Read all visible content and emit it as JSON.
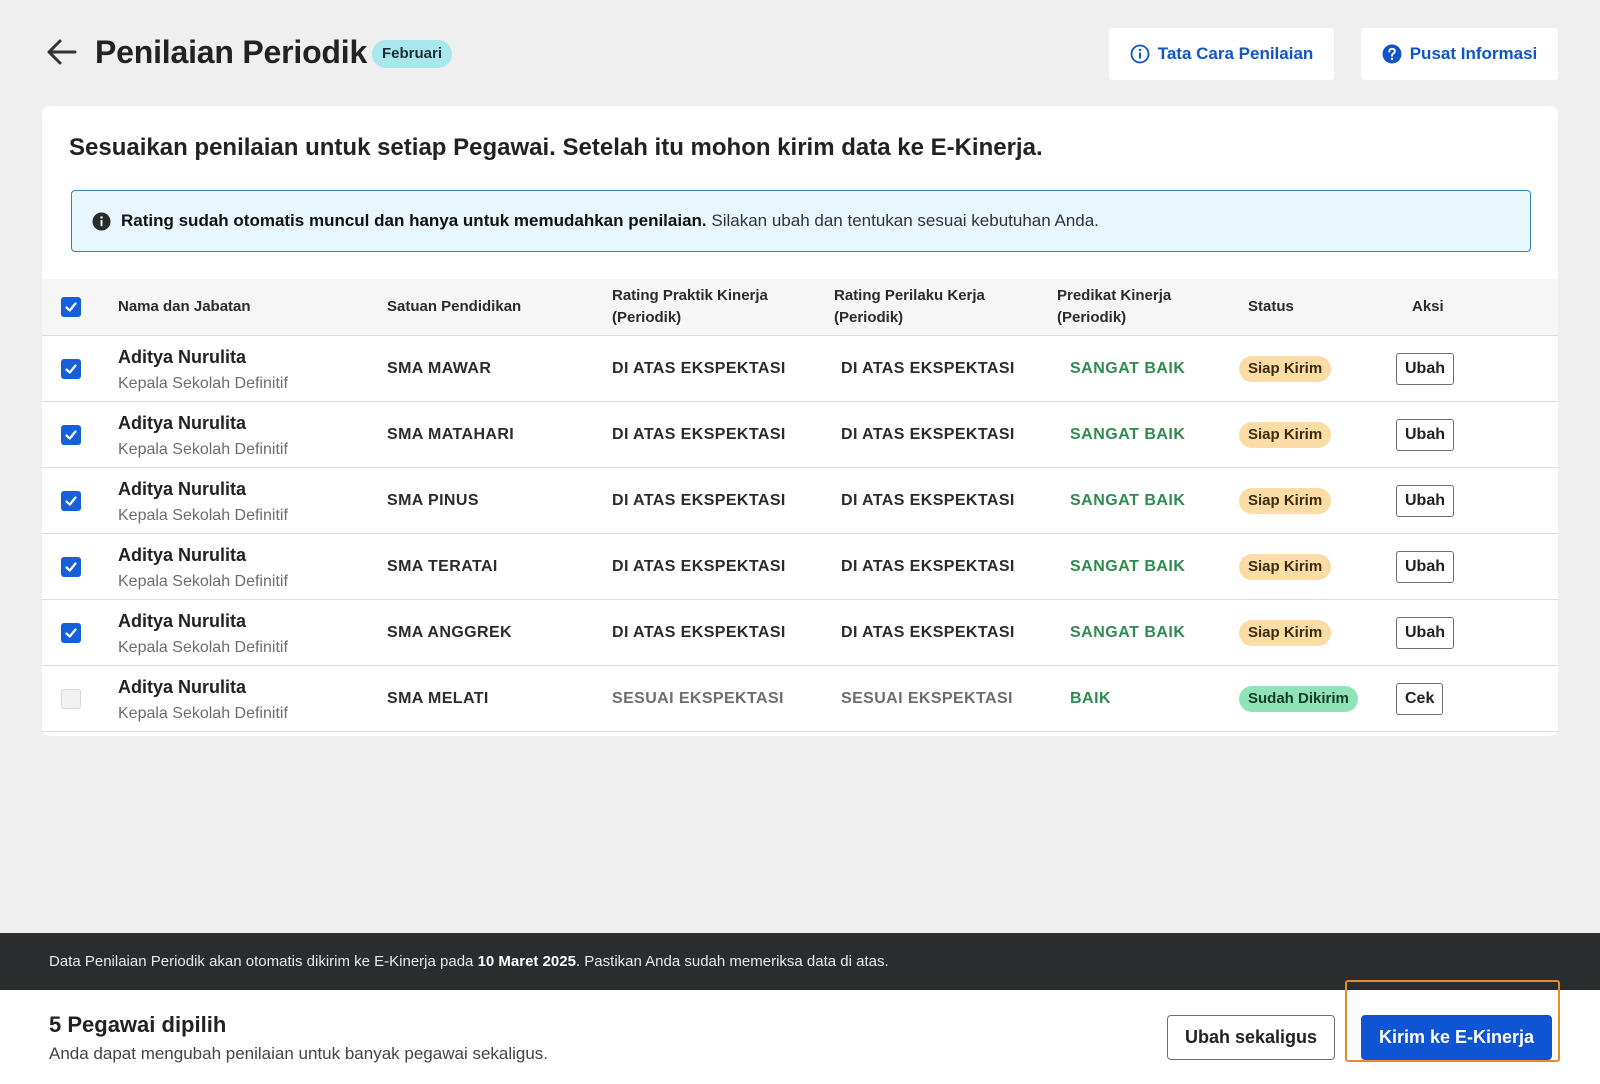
{
  "header": {
    "title": "Penilaian Periodik",
    "month_badge": "Februari",
    "tata_cara_label": "Tata Cara Penilaian",
    "pusat_info_label": "Pusat Informasi"
  },
  "card": {
    "heading": "Sesuaikan penilaian untuk setiap Pegawai. Setelah itu mohon kirim data ke E-Kinerja.",
    "info_bold": "Rating sudah otomatis muncul dan hanya untuk memudahkan penilaian.",
    "info_rest": "Silakan ubah dan tentukan sesuai kebutuhan Anda."
  },
  "table": {
    "columns": {
      "name": "Nama dan Jabatan",
      "unit": "Satuan Pendidikan",
      "rating_praktik_1": "Rating Praktik Kinerja",
      "rating_praktik_2": "(Periodik)",
      "rating_perilaku_1": "Rating Perilaku Kerja",
      "rating_perilaku_2": "(Periodik)",
      "predikat_1": "Predikat Kinerja",
      "predikat_2": "(Periodik)",
      "status": "Status",
      "aksi": "Aksi"
    },
    "rows": [
      {
        "checked": true,
        "name": "Aditya Nurulita",
        "role": "Kepala Sekolah Definitif",
        "unit": "SMA MAWAR",
        "rating_praktik": "DI ATAS EKSPEKTASI",
        "rating_perilaku": "DI ATAS EKSPEKTASI",
        "predikat": "SANGAT BAIK",
        "status": "Siap Kirim",
        "action": "Ubah"
      },
      {
        "checked": true,
        "name": "Aditya Nurulita",
        "role": "Kepala Sekolah Definitif",
        "unit": "SMA MATAHARI",
        "rating_praktik": "DI ATAS EKSPEKTASI",
        "rating_perilaku": "DI ATAS EKSPEKTASI",
        "predikat": "SANGAT BAIK",
        "status": "Siap Kirim",
        "action": "Ubah"
      },
      {
        "checked": true,
        "name": "Aditya Nurulita",
        "role": "Kepala Sekolah Definitif",
        "unit": "SMA PINUS",
        "rating_praktik": "DI ATAS EKSPEKTASI",
        "rating_perilaku": "DI ATAS EKSPEKTASI",
        "predikat": "SANGAT BAIK",
        "status": "Siap Kirim",
        "action": "Ubah"
      },
      {
        "checked": true,
        "name": "Aditya Nurulita",
        "role": "Kepala Sekolah Definitif",
        "unit": "SMA TERATAI",
        "rating_praktik": "DI ATAS EKSPEKTASI",
        "rating_perilaku": "DI ATAS EKSPEKTASI",
        "predikat": "SANGAT BAIK",
        "status": "Siap Kirim",
        "action": "Ubah"
      },
      {
        "checked": true,
        "name": "Aditya Nurulita",
        "role": "Kepala Sekolah Definitif",
        "unit": "SMA ANGGREK",
        "rating_praktik": "DI ATAS EKSPEKTASI",
        "rating_perilaku": "DI ATAS EKSPEKTASI",
        "predikat": "SANGAT BAIK",
        "status": "Siap Kirim",
        "action": "Ubah"
      },
      {
        "checked": false,
        "name": "Aditya Nurulita",
        "role": "Kepala Sekolah Definitif",
        "unit": "SMA MELATI",
        "rating_praktik": "SESUAI EKSPEKTASI",
        "rating_perilaku": "SESUAI EKSPEKTASI",
        "predikat": "BAIK",
        "status": "Sudah Dikirim",
        "action": "Cek"
      }
    ]
  },
  "footer": {
    "notice_pre": "Data Penilaian Periodik akan otomatis dikirim ke E-Kinerja pada",
    "notice_date": "10 Maret 2025",
    "notice_post": ". Pastikan Anda sudah memeriksa data di atas.",
    "selected_count": "5 Pegawai dipilih",
    "selected_hint": "Anda dapat mengubah penilaian untuk banyak pegawai sekaligus.",
    "bulk_edit_label": "Ubah sekaligus",
    "send_label": "Kirim ke E-Kinerja"
  },
  "colors": {
    "accent": "#0f55d3",
    "predikat_green": "#2f8a4e",
    "status_ready": "#fbdca4",
    "status_sent": "#8ee3b8",
    "highlight_frame": "#e8892e"
  },
  "icons": [
    "arrow-left-icon",
    "info-circle-icon",
    "help-circle-icon",
    "info-filled-icon",
    "check-icon"
  ]
}
